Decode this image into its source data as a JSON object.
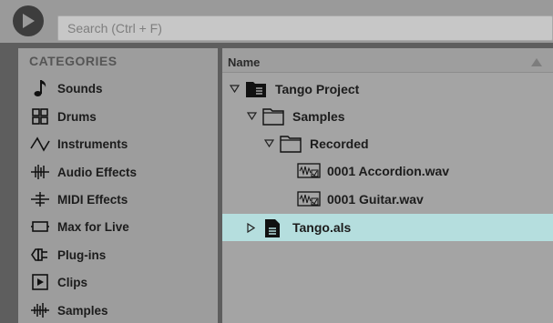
{
  "search": {
    "placeholder": "Search (Ctrl + F)"
  },
  "sidebar": {
    "title": "CATEGORIES",
    "items": [
      {
        "label": "Sounds",
        "icon": "note-icon"
      },
      {
        "label": "Drums",
        "icon": "drum-grid-icon"
      },
      {
        "label": "Instruments",
        "icon": "wave-icon"
      },
      {
        "label": "Audio Effects",
        "icon": "audio-effects-icon"
      },
      {
        "label": "MIDI Effects",
        "icon": "midi-effects-icon"
      },
      {
        "label": "Max for Live",
        "icon": "max-for-live-icon"
      },
      {
        "label": "Plug-ins",
        "icon": "plug-icon"
      },
      {
        "label": "Clips",
        "icon": "clip-icon"
      },
      {
        "label": "Samples",
        "icon": "sample-wave-icon"
      }
    ]
  },
  "files": {
    "header": "Name",
    "rows": [
      {
        "label": "Tango Project",
        "icon": "project-folder-icon",
        "expanded": true,
        "selected": false
      },
      {
        "label": "Samples",
        "icon": "folder-icon",
        "expanded": true,
        "selected": false
      },
      {
        "label": "Recorded",
        "icon": "folder-icon",
        "expanded": true,
        "selected": false
      },
      {
        "label": "0001 Accordion.wav",
        "icon": "audio-file-icon",
        "selected": false
      },
      {
        "label": "0001 Guitar.wav",
        "icon": "audio-file-icon",
        "selected": false
      },
      {
        "label": "Tango.als",
        "icon": "live-set-icon",
        "expanded": false,
        "selected": true
      }
    ]
  },
  "colors": {
    "selection": "#b5dede",
    "sidebar_bg": "#9d9d9d",
    "list_bg": "#a4a4a4"
  }
}
